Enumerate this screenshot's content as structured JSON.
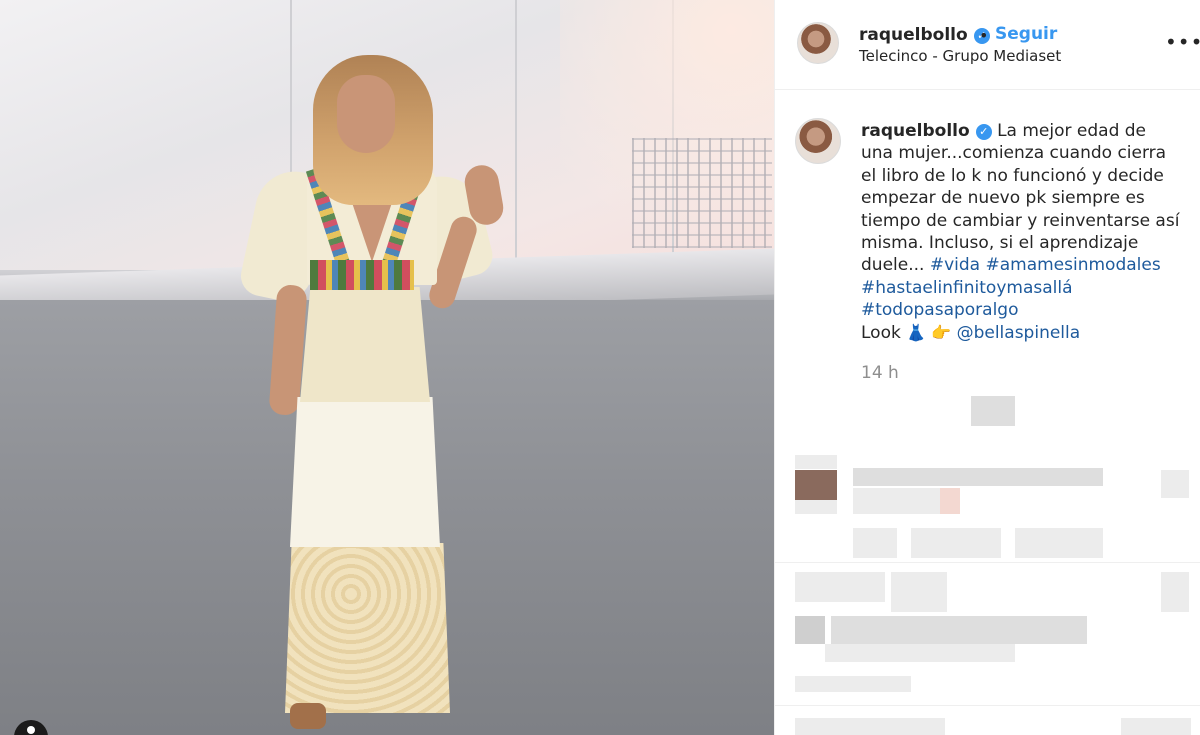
{
  "header": {
    "username": "raquelbollo",
    "separator": "•",
    "follow_label": "Seguir",
    "location": "Telecinco - Grupo Mediaset",
    "more_icon": "more-horizontal-icon"
  },
  "caption": {
    "username": "raquelbollo",
    "text": "La mejor edad de una mujer...comienza cuando cierra el libro de lo k no funcionó y decide empezar de nuevo pk siempre es tiempo de cambiar y reinventarse así misma. Incluso, si el aprendizaje duele...",
    "hashtags": [
      "#vida",
      "#amamesinmodales",
      "#hastaelinfinitoymasallá",
      "#todopasaporalgo"
    ],
    "look_label": "Look",
    "emojis": "👗 👉",
    "mention": "@bellaspinella",
    "time": "14 h"
  },
  "colors": {
    "link_blue": "#3897f0",
    "hashtag_blue": "#1e5a9c",
    "text": "#262626",
    "muted": "#8e8e8e"
  }
}
